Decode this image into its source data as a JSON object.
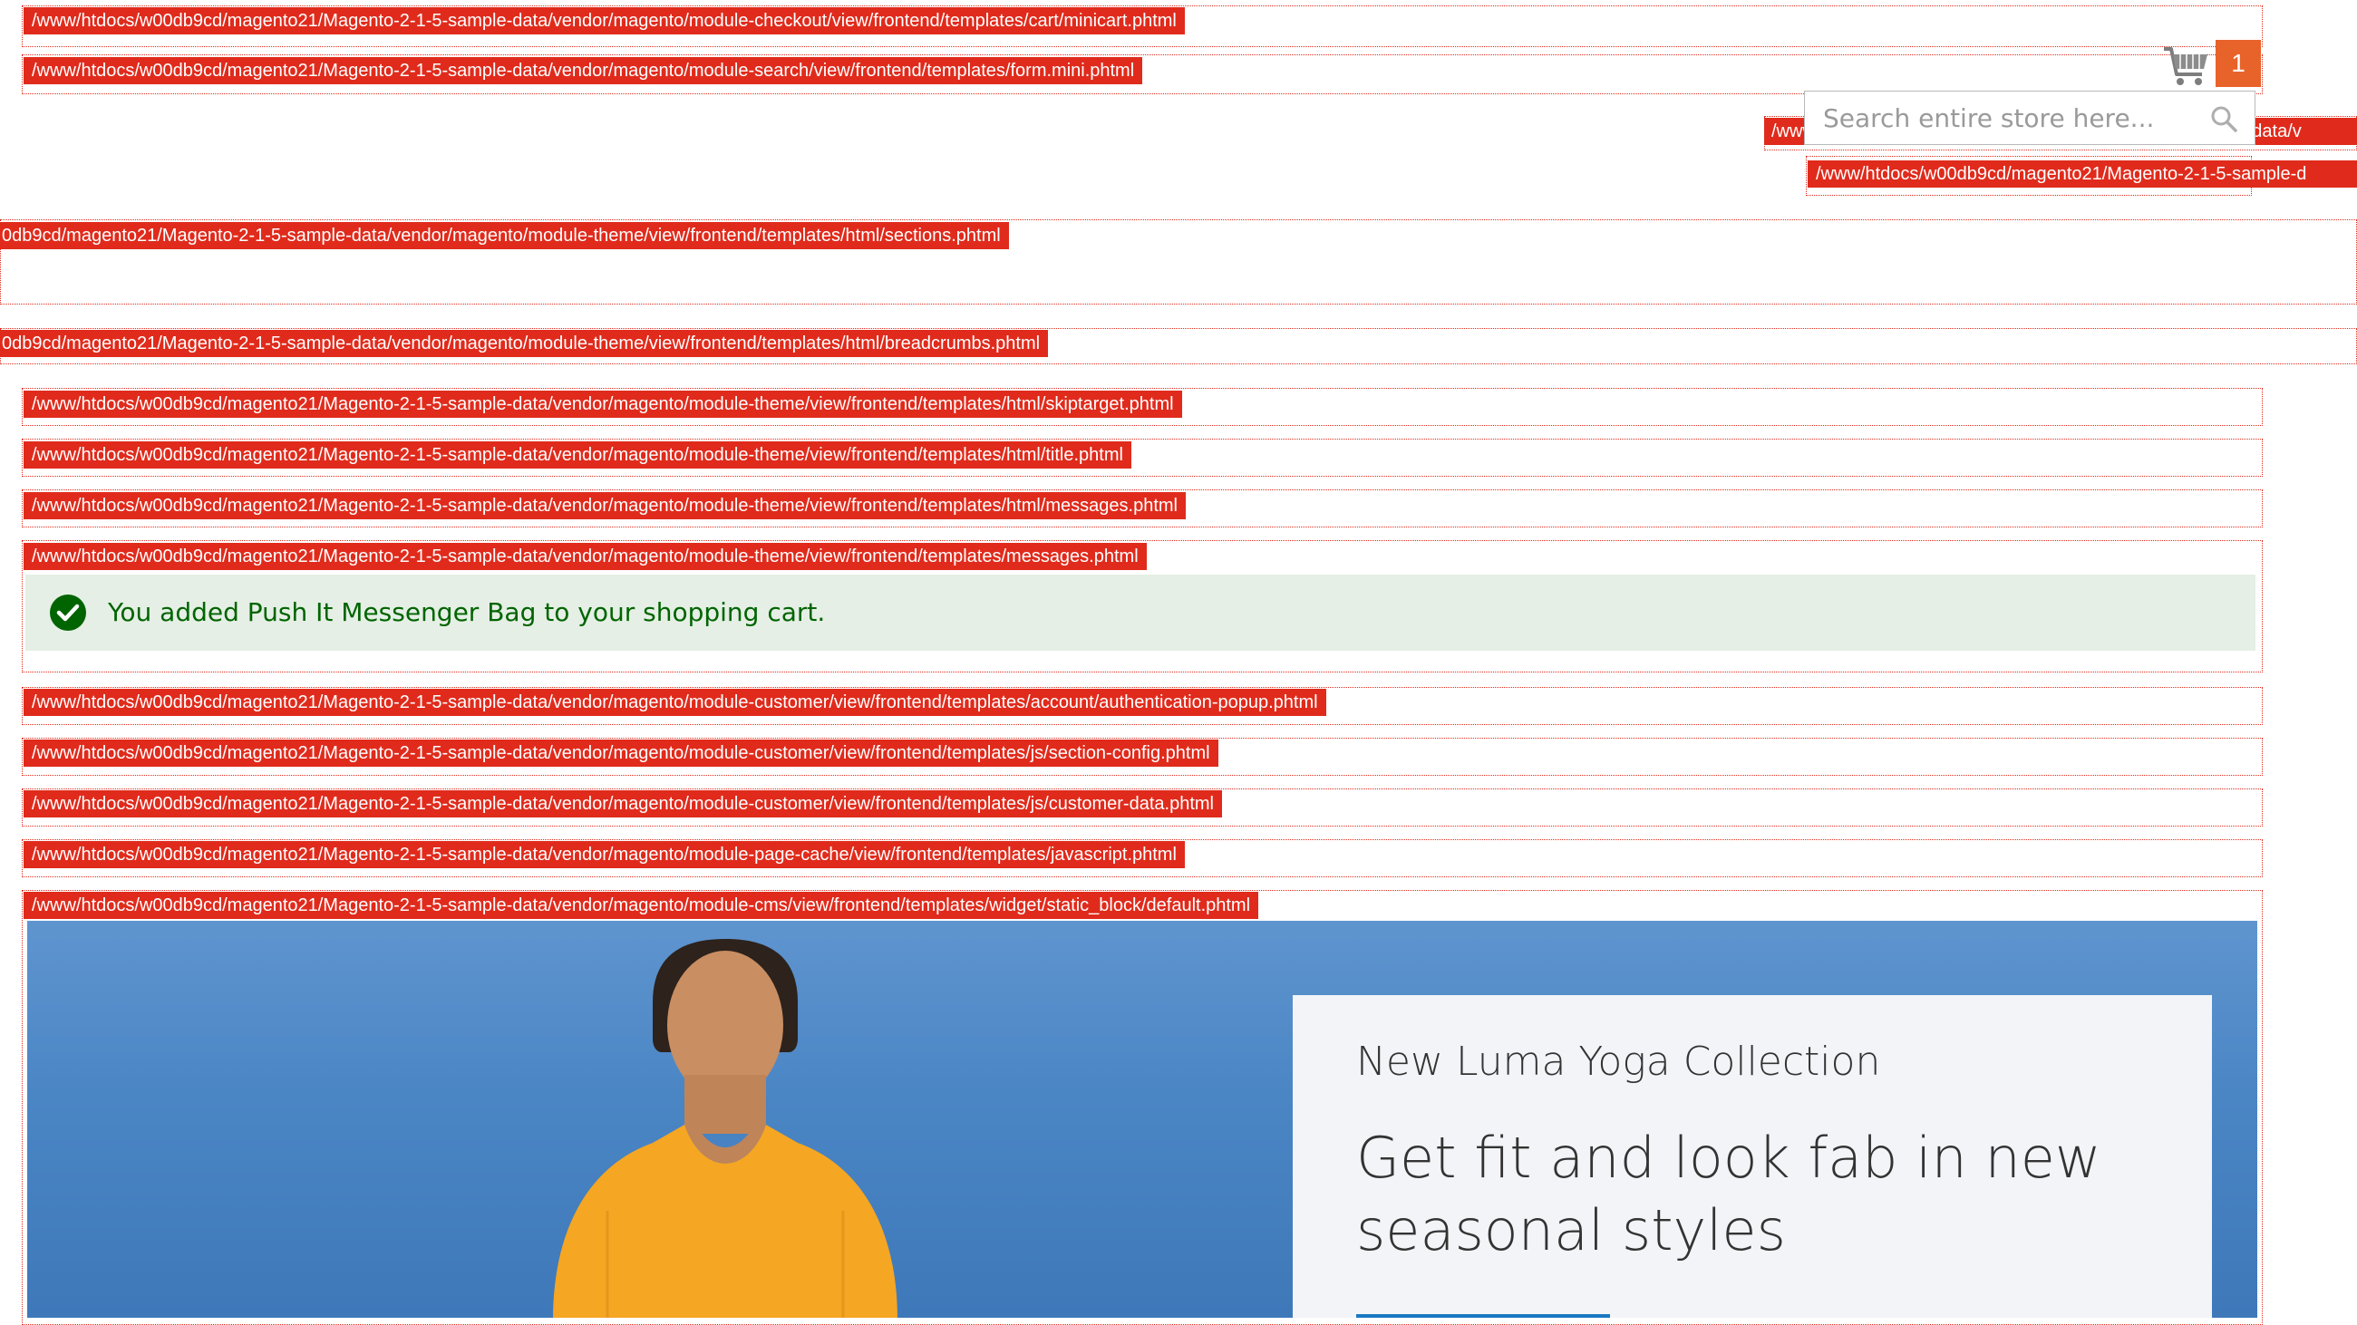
{
  "template_hints": [
    {
      "id": "minicart",
      "text": "/www/htdocs/w00db9cd/magento21/Magento-2-1-5-sample-data/vendor/magento/module-checkout/view/frontend/templates/cart/minicart.phtml"
    },
    {
      "id": "form-mini",
      "text": "/www/htdocs/w00db9cd/magento21/Magento-2-1-5-sample-data/vendor/magento/module-search/view/frontend/templates/form.mini.phtml"
    },
    {
      "id": "search-overlap-a",
      "text": "/www/htdocs/w00db9cd/magento21/Magento-2-1-5-sample-data/v"
    },
    {
      "id": "search-overlap-b",
      "text": "/www/htdocs/w00db9cd/magento21/Magento-2-1-5-sample-d"
    },
    {
      "id": "sections",
      "text": "0db9cd/magento21/Magento-2-1-5-sample-data/vendor/magento/module-theme/view/frontend/templates/html/sections.phtml"
    },
    {
      "id": "breadcrumbs",
      "text": "0db9cd/magento21/Magento-2-1-5-sample-data/vendor/magento/module-theme/view/frontend/templates/html/breadcrumbs.phtml"
    },
    {
      "id": "skiptarget",
      "text": "/www/htdocs/w00db9cd/magento21/Magento-2-1-5-sample-data/vendor/magento/module-theme/view/frontend/templates/html/skiptarget.phtml"
    },
    {
      "id": "title",
      "text": "/www/htdocs/w00db9cd/magento21/Magento-2-1-5-sample-data/vendor/magento/module-theme/view/frontend/templates/html/title.phtml"
    },
    {
      "id": "html-messages",
      "text": "/www/htdocs/w00db9cd/magento21/Magento-2-1-5-sample-data/vendor/magento/module-theme/view/frontend/templates/html/messages.phtml"
    },
    {
      "id": "messages",
      "text": "/www/htdocs/w00db9cd/magento21/Magento-2-1-5-sample-data/vendor/magento/module-theme/view/frontend/templates/messages.phtml"
    },
    {
      "id": "auth-popup",
      "text": "/www/htdocs/w00db9cd/magento21/Magento-2-1-5-sample-data/vendor/magento/module-customer/view/frontend/templates/account/authentication-popup.phtml"
    },
    {
      "id": "section-config",
      "text": "/www/htdocs/w00db9cd/magento21/Magento-2-1-5-sample-data/vendor/magento/module-customer/view/frontend/templates/js/section-config.phtml"
    },
    {
      "id": "customer-data",
      "text": "/www/htdocs/w00db9cd/magento21/Magento-2-1-5-sample-data/vendor/magento/module-customer/view/frontend/templates/js/customer-data.phtml"
    },
    {
      "id": "page-cache-js",
      "text": "/www/htdocs/w00db9cd/magento21/Magento-2-1-5-sample-data/vendor/magento/module-page-cache/view/frontend/templates/javascript.phtml"
    },
    {
      "id": "static-block",
      "text": "/www/htdocs/w00db9cd/magento21/Magento-2-1-5-sample-data/vendor/magento/module-cms/view/frontend/templates/widget/static_block/default.phtml"
    }
  ],
  "minicart": {
    "count": "1",
    "icon": "cart-icon"
  },
  "search": {
    "placeholder": "Search entire store here...",
    "icon": "search-icon"
  },
  "message": {
    "text": "You added Push It Messenger Bag to your shopping cart.",
    "icon": "check-circle-icon"
  },
  "banner": {
    "subtitle": "New Luma Yoga Collection",
    "title": "Get fit and look fab in new seasonal styles"
  },
  "colors": {
    "hint": "#e02b1c",
    "cart_badge": "#e8632a",
    "success_bg": "#e5efe5",
    "success_text": "#006400",
    "button": "#1979c3"
  }
}
